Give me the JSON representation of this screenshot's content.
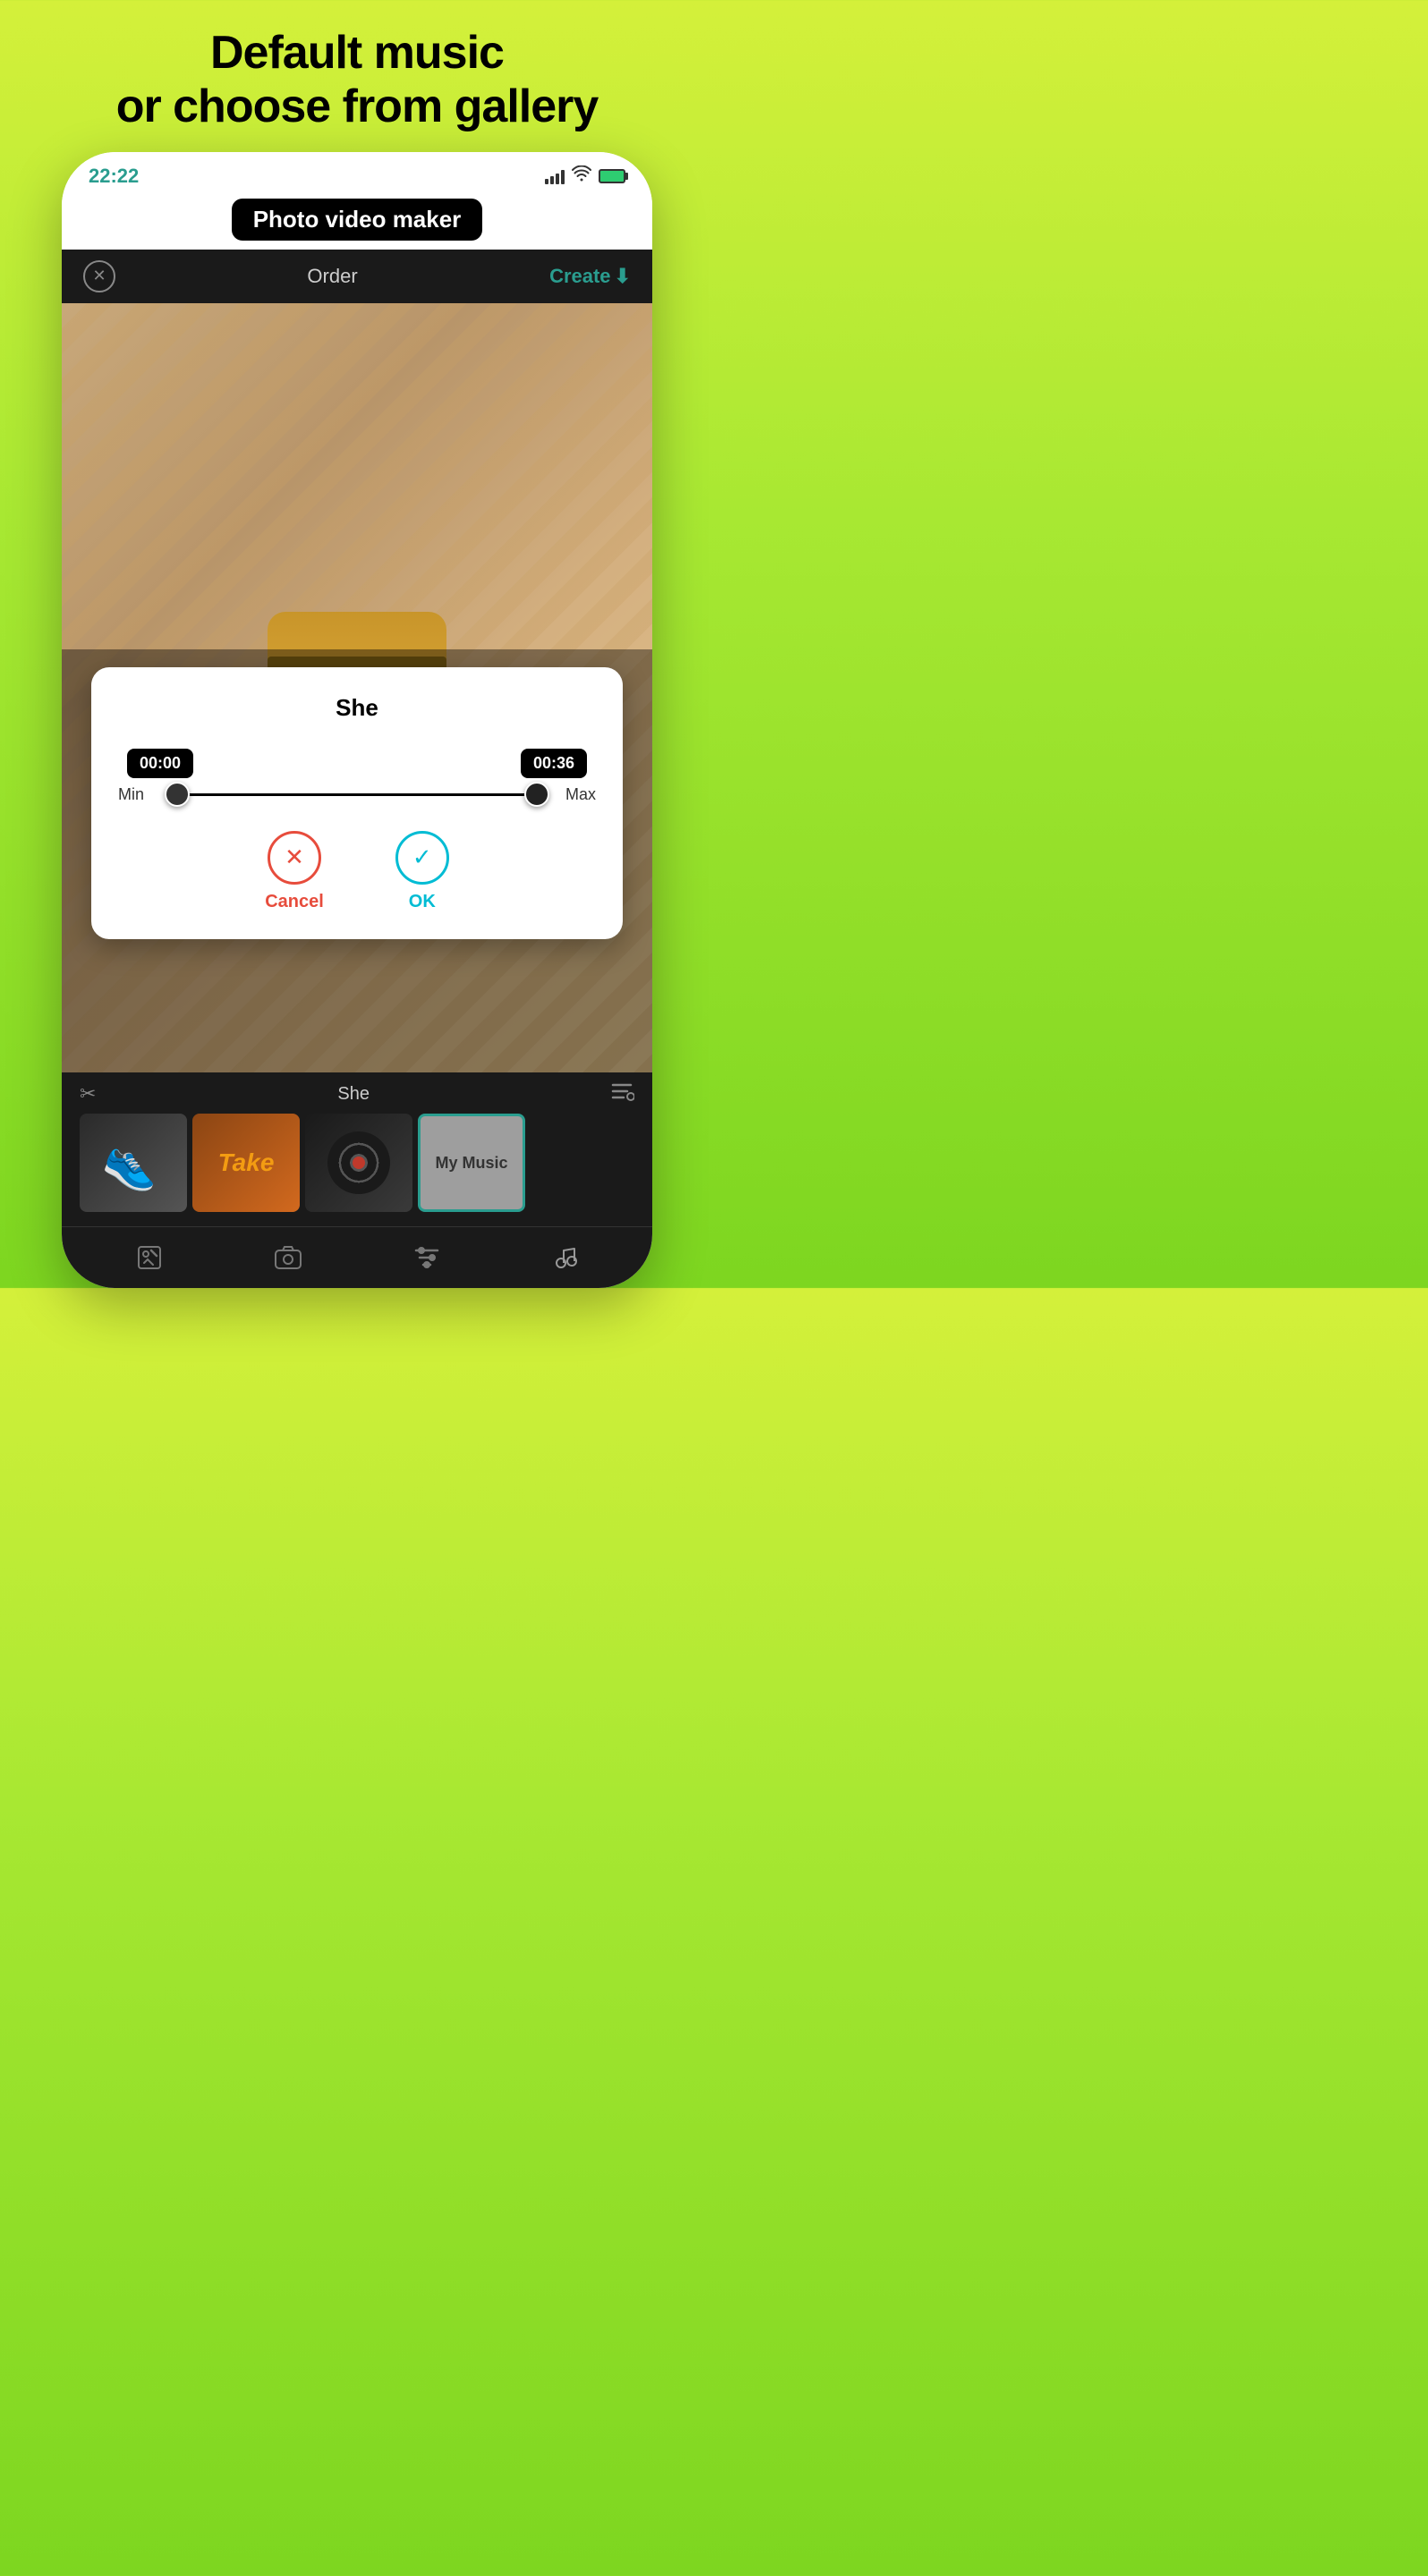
{
  "heading": {
    "line1": "Default music",
    "line2": "or choose from gallery"
  },
  "phone": {
    "statusBar": {
      "time": "22:22"
    },
    "appTitleBadge": "Photo video maker",
    "toolbar": {
      "title": "Order",
      "createLabel": "Create"
    },
    "modal": {
      "songTitle": "She",
      "timeStart": "00:00",
      "timeEnd": "00:36",
      "minLabel": "Min",
      "maxLabel": "Max",
      "cancelLabel": "Cancel",
      "okLabel": "OK"
    },
    "bottomBar": {
      "songName": "She"
    },
    "musicThumbs": [
      {
        "id": "thumb-shoes",
        "type": "shoes"
      },
      {
        "id": "thumb-take",
        "text": "Take",
        "type": "take"
      },
      {
        "id": "thumb-vinyl",
        "type": "vinyl"
      },
      {
        "id": "thumb-mymusic",
        "text": "My Music",
        "type": "mymusic"
      }
    ],
    "bottomNav": {
      "icons": [
        "edit",
        "camera",
        "settings",
        "music"
      ]
    }
  }
}
